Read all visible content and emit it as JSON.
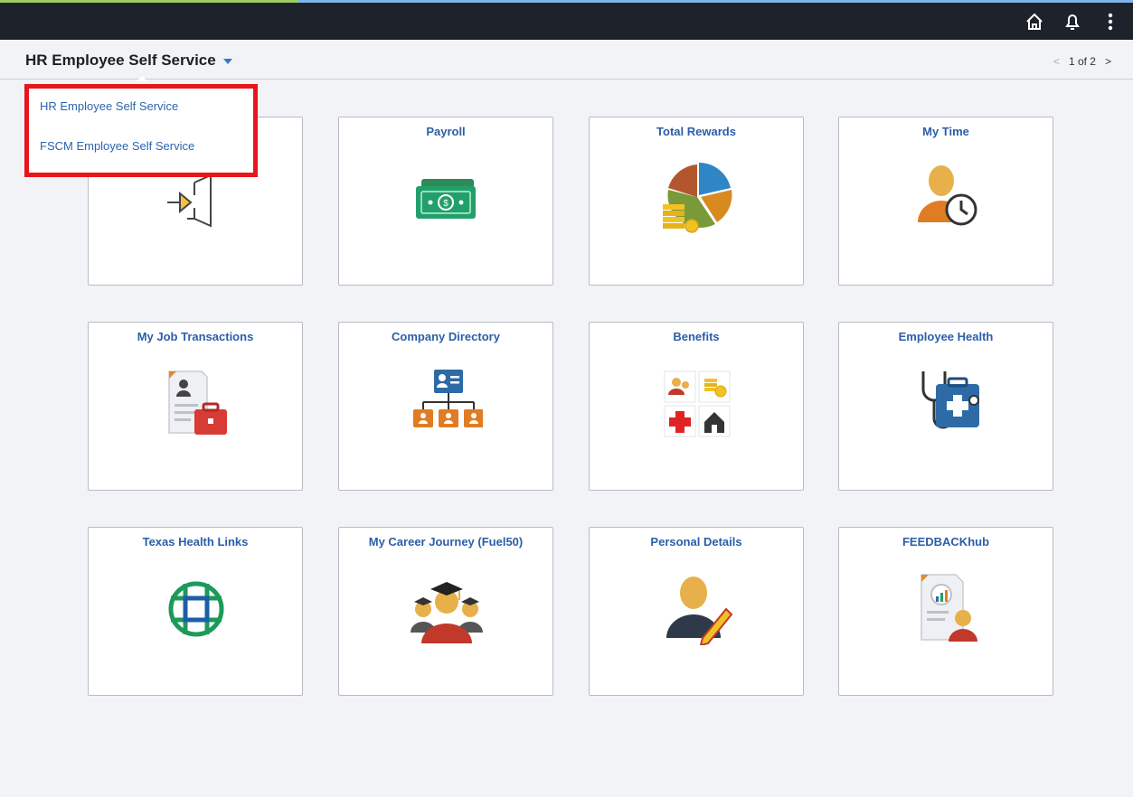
{
  "header": {
    "title": "HR Employee Self Service",
    "pager": {
      "prev": "<",
      "text": "1 of 2",
      "next": ">"
    }
  },
  "dropdown": {
    "options": [
      "HR Employee Self Service",
      "FSCM Employee Self Service"
    ]
  },
  "tiles": [
    {
      "label": ""
    },
    {
      "label": "Payroll"
    },
    {
      "label": "Total Rewards"
    },
    {
      "label": "My Time"
    },
    {
      "label": "My Job Transactions"
    },
    {
      "label": "Company Directory"
    },
    {
      "label": "Benefits"
    },
    {
      "label": "Employee Health"
    },
    {
      "label": "Texas Health Links"
    },
    {
      "label": "My Career Journey (Fuel50)"
    },
    {
      "label": "Personal Details"
    },
    {
      "label": "FEEDBACKhub"
    }
  ]
}
